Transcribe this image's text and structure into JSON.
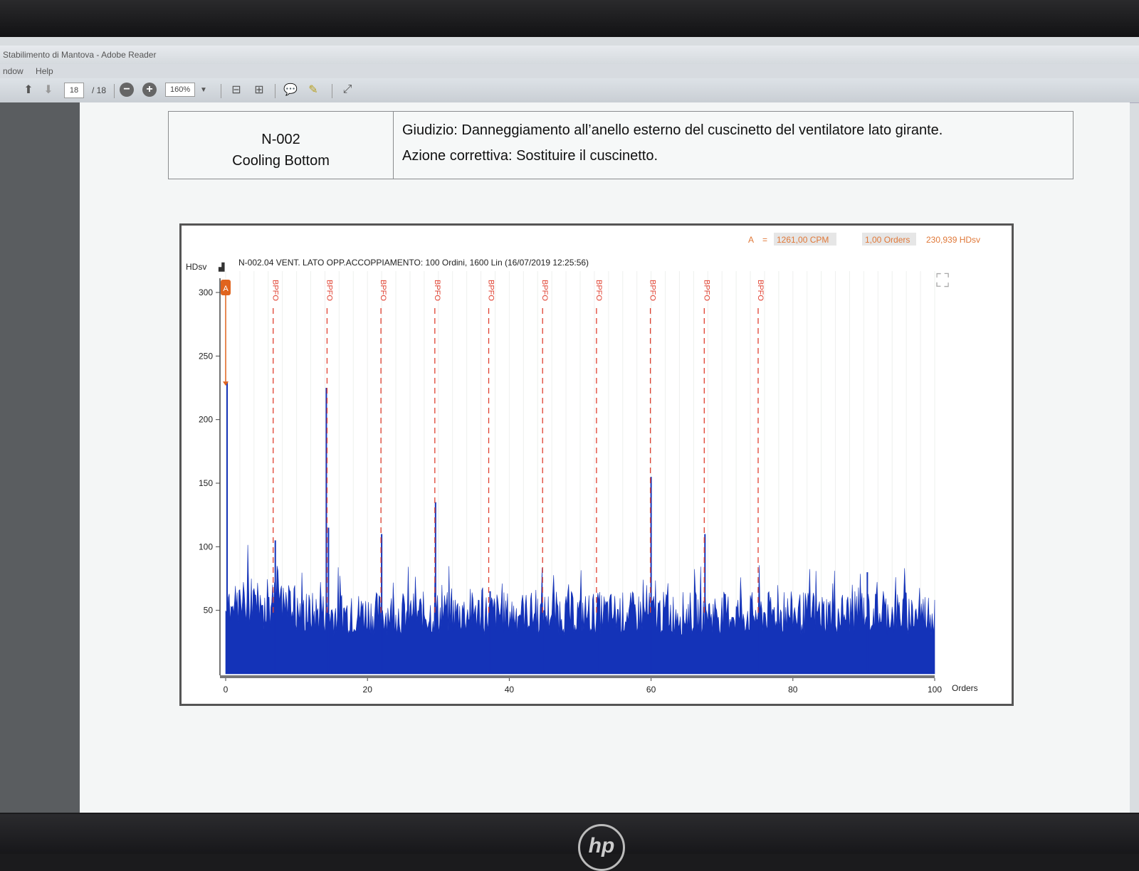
{
  "window": {
    "title": "Stabilimento di Mantova - Adobe Reader"
  },
  "menu": [
    "ndow",
    "Help"
  ],
  "toolbar": {
    "page_current": "18",
    "page_total": "/ 18",
    "zoom": "160%"
  },
  "info": {
    "code": "N-002",
    "name": "Cooling Bottom",
    "judgement": "Giudizio: Danneggiamento all’anello esterno del cuscinetto del ventilatore lato girante.",
    "action": "Azione correttiva: Sostituire il cuscinetto."
  },
  "cursor_readout": {
    "label": "A",
    "eq": "=",
    "cpm": "1261,00 CPM",
    "orders": "1,00 Orders",
    "amp": "230,939 HDsv"
  },
  "chart_data": {
    "type": "bar",
    "title": "N-002.04 VENT. LATO OPP.ACCOPPIAMENTO: 100 Ordini, 1600 Lin (16/07/2019 12:25:56)",
    "ylabel": "HDsv",
    "xlabel": "Orders",
    "xlim": [
      0,
      100
    ],
    "ylim": [
      0,
      300
    ],
    "xticks": [
      0,
      20,
      40,
      60,
      80,
      100
    ],
    "yticks": [
      50,
      100,
      150,
      200,
      250,
      300
    ],
    "cursor_marker": {
      "label": "A",
      "x": 0,
      "y": 230
    },
    "bpfo_lines": [
      {
        "label": "BPFO",
        "x": 6.7
      },
      {
        "label": "BPFO",
        "x": 14.3
      },
      {
        "label": "BPFO",
        "x": 21.9
      },
      {
        "label": "BPFO",
        "x": 29.5
      },
      {
        "label": "BPFO",
        "x": 37.1
      },
      {
        "label": "BPFO",
        "x": 44.7
      },
      {
        "label": "BPFO",
        "x": 52.3
      },
      {
        "label": "BPFO",
        "x": 59.9
      },
      {
        "label": "BPFO",
        "x": 67.5
      },
      {
        "label": "BPFO",
        "x": 75.1
      }
    ],
    "peaks": [
      {
        "x": 0.2,
        "y": 230
      },
      {
        "x": 7.0,
        "y": 105
      },
      {
        "x": 14.2,
        "y": 225
      },
      {
        "x": 14.5,
        "y": 115
      },
      {
        "x": 22.0,
        "y": 110
      },
      {
        "x": 29.6,
        "y": 135
      },
      {
        "x": 37.3,
        "y": 65
      },
      {
        "x": 44.9,
        "y": 50
      },
      {
        "x": 52.5,
        "y": 60
      },
      {
        "x": 60.0,
        "y": 155
      },
      {
        "x": 67.6,
        "y": 110
      },
      {
        "x": 75.1,
        "y": 45
      },
      {
        "x": 90.5,
        "y": 80
      }
    ],
    "noise_floor": 30,
    "noise_range": 35
  },
  "colors": {
    "spectrum": "#1433b8",
    "bpfo": "#e04030",
    "marker": "#e0641e",
    "readout": "#e07838"
  },
  "taskbar": [
    "task-view",
    "edge",
    "explorer",
    "outlook",
    "calculator",
    "remote",
    "notes",
    "acrobat"
  ],
  "logo": "hp"
}
